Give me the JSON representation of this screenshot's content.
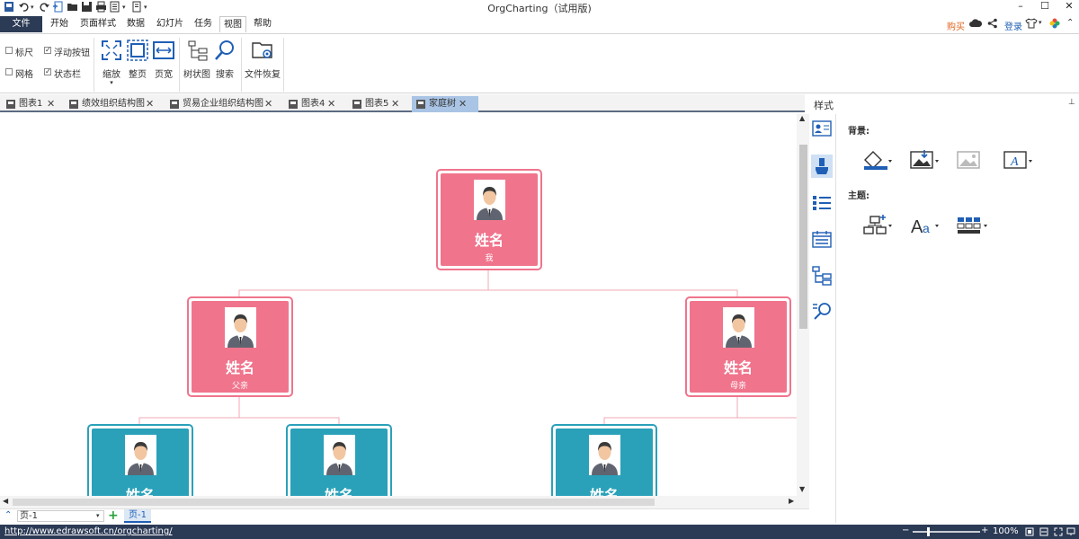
{
  "window": {
    "title": "OrgCharting（试用版)",
    "buy": "购买",
    "login": "登录"
  },
  "menu": [
    "文件",
    "开始",
    "页面样式",
    "数据",
    "幻灯片",
    "任务",
    "视图",
    "帮助"
  ],
  "ribbon": {
    "checkboxes": [
      {
        "label": "标尺",
        "checked": false
      },
      {
        "label": "网格",
        "checked": false
      },
      {
        "label": "浮动按钮",
        "checked": true
      },
      {
        "label": "状态栏",
        "checked": true
      }
    ],
    "buttons": [
      "缩放",
      "整页",
      "页宽",
      "树状图",
      "搜索",
      "文件恢复"
    ]
  },
  "doc_tabs": [
    "图表1",
    "绩效组织结构图",
    "贸易企业组织结构图",
    "图表4",
    "图表5",
    "家庭树"
  ],
  "chart": {
    "nodes": [
      {
        "name": "姓名",
        "role": "我"
      },
      {
        "name": "姓名",
        "role": "父亲"
      },
      {
        "name": "姓名",
        "role": "母亲"
      },
      {
        "name": "姓名",
        "role": ""
      },
      {
        "name": "姓名",
        "role": ""
      },
      {
        "name": "姓名",
        "role": ""
      }
    ],
    "colors": {
      "pink": "#f0748c",
      "teal": "#2aa1b9",
      "line_pink": "#f1a8b7"
    }
  },
  "style_panel": {
    "title": "样式",
    "background_label": "背景:",
    "theme_label": "主题:"
  },
  "pagebar": {
    "page_select": "页-1",
    "add": "+",
    "page_tab": "页-1"
  },
  "statusbar": {
    "url": "http://www.edrawsoft.cn/orgcharting/",
    "zoom": "100%"
  }
}
